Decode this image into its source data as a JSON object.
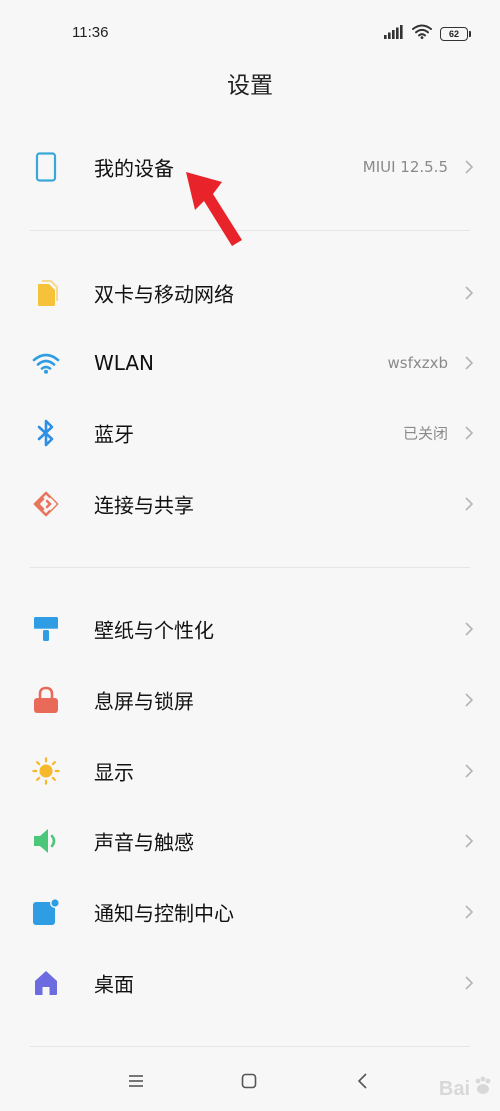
{
  "status_bar": {
    "time": "11:36",
    "battery": "62"
  },
  "header": {
    "title": "设置"
  },
  "sections": [
    {
      "items": [
        {
          "label": "我的设备",
          "value": "MIUI 12.5.5",
          "icon": "phone-icon",
          "color": "#3aa7d9"
        }
      ]
    },
    {
      "items": [
        {
          "label": "双卡与移动网络",
          "value": "",
          "icon": "sim-card-icon",
          "color": "#f6c23a"
        },
        {
          "label": "WLAN",
          "value": "wsfxzxb",
          "icon": "wifi-icon",
          "color": "#2f9de4"
        },
        {
          "label": "蓝牙",
          "value": "已关闭",
          "icon": "bluetooth-icon",
          "color": "#2f8fe4"
        },
        {
          "label": "连接与共享",
          "value": "",
          "icon": "connection-share-icon",
          "color": "#e8765e"
        }
      ]
    },
    {
      "items": [
        {
          "label": "壁纸与个性化",
          "value": "",
          "icon": "wallpaper-brush-icon",
          "color": "#2f9de4"
        },
        {
          "label": "息屏与锁屏",
          "value": "",
          "icon": "lock-icon",
          "color": "#ea6a5a"
        },
        {
          "label": "显示",
          "value": "",
          "icon": "sun-icon",
          "color": "#f6b92c"
        },
        {
          "label": "声音与触感",
          "value": "",
          "icon": "speaker-icon",
          "color": "#4cc77a"
        },
        {
          "label": "通知与控制中心",
          "value": "",
          "icon": "notification-icon",
          "color": "#2f9de4"
        },
        {
          "label": "桌面",
          "value": "",
          "icon": "home-icon",
          "color": "#6c6ce0"
        }
      ]
    }
  ],
  "watermark": {
    "text": "Bai"
  }
}
